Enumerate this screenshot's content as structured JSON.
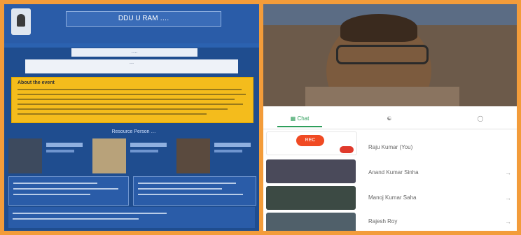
{
  "left_pane": {
    "org_title": "DDU U RAM ….",
    "event_badge": "….",
    "subtitle": "…",
    "about_title": "About the event",
    "speakers_label": "Resource Person …"
  },
  "video": {
    "top_left": "",
    "top_right": ""
  },
  "tabs": [
    {
      "label": "Chat",
      "active": true
    },
    {
      "label": "",
      "active": false
    },
    {
      "label": "",
      "active": false
    }
  ],
  "tiles": {
    "record_label": "REC"
  },
  "participants": [
    {
      "name": "Raju Kumar (You)",
      "mark": ""
    },
    {
      "name": "Anand Kumar Sinha",
      "mark": "→"
    },
    {
      "name": "Manoj Kumar Saha",
      "mark": "→"
    },
    {
      "name": "Rajesh Roy",
      "mark": "→"
    }
  ],
  "colors": {
    "frame": "#f39c3a",
    "poster_blue": "#1f4d8f",
    "about_yellow": "#f4bc1c",
    "accent_green": "#2e9e5b",
    "record_red": "#f04a23"
  }
}
